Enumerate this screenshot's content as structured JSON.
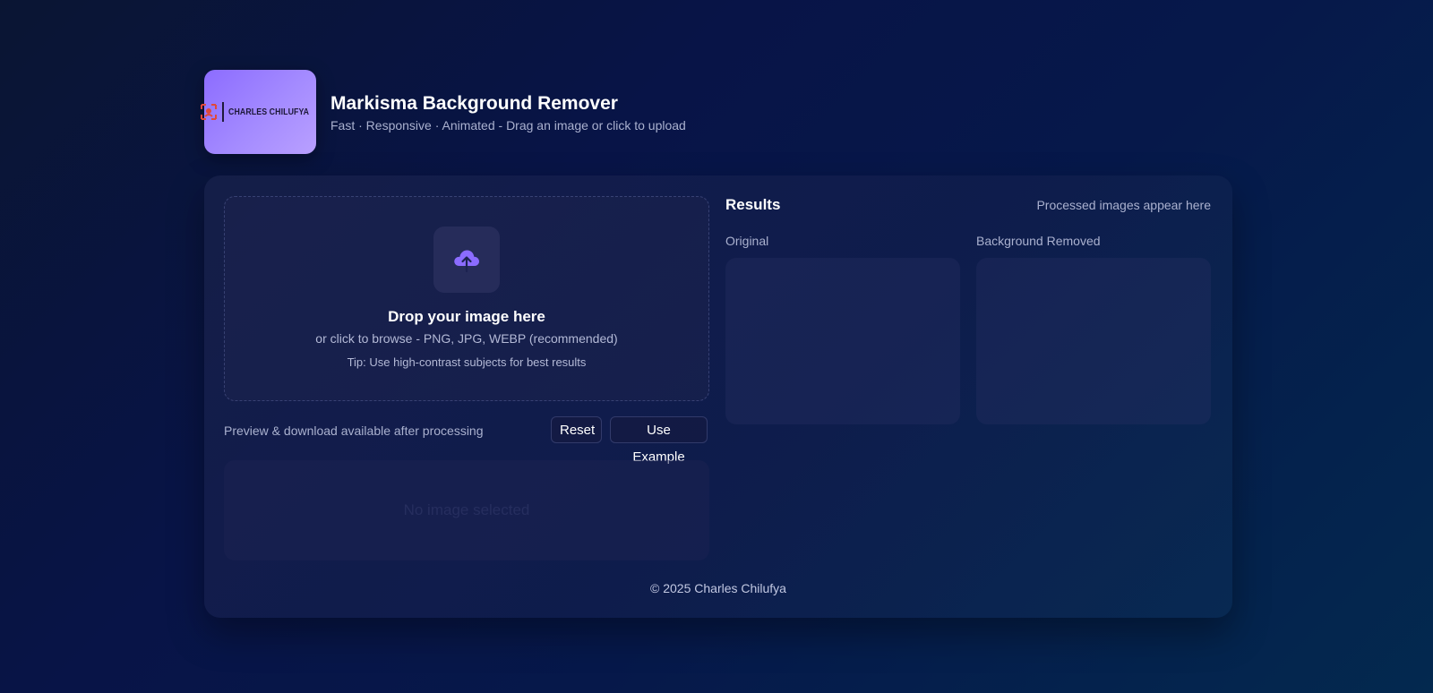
{
  "header": {
    "logo_text": "CHARLES CHILUFYA",
    "title": "Markisma Background Remover",
    "subtitle": "Fast · Responsive · Animated - Drag an image or click to upload"
  },
  "dropzone": {
    "icon": "cloud-upload-icon",
    "title": "Drop your image here",
    "subtitle": "or click to browse - PNG, JPG, WEBP (recommended)",
    "tip": "Tip: Use high-contrast subjects for best results"
  },
  "actions": {
    "note": "Preview & download available after processing",
    "reset_label": "Reset",
    "example_label": "Use Example"
  },
  "preview": {
    "empty_text": "No image selected"
  },
  "results": {
    "title": "Results",
    "note": "Processed images appear here",
    "original_label": "Original",
    "removed_label": "Background Removed"
  },
  "footer": {
    "text": "© 2025 Charles Chilufya"
  },
  "colors": {
    "accent": "#8b6cff",
    "logo_mark": "#e0483a"
  }
}
